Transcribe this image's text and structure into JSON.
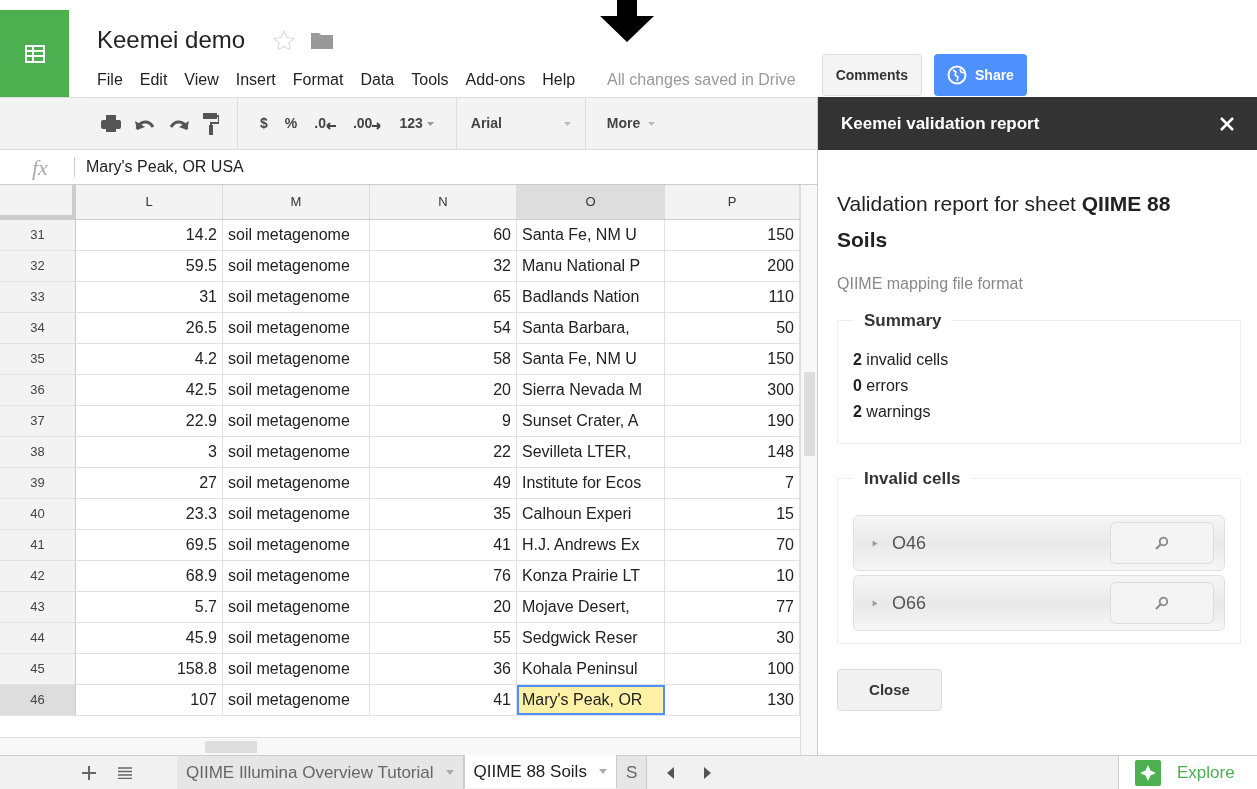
{
  "app": {
    "title": "Keemei demo",
    "starred": false,
    "menu": [
      "File",
      "Edit",
      "View",
      "Insert",
      "Format",
      "Data",
      "Tools",
      "Add-ons",
      "Help"
    ],
    "save_status": "All changes saved in Drive",
    "comments": "Comments",
    "share": "Share"
  },
  "toolbar": {
    "currency": "$",
    "percent": "%",
    "decrease_decimals": ".0",
    "increase_decimals": ".00",
    "number_format": "123",
    "font": "Arial",
    "more": "More"
  },
  "formula_bar": {
    "label": "fx",
    "value": "Mary's Peak, OR USA"
  },
  "sheet": {
    "columns": [
      {
        "label": "L",
        "selected": false
      },
      {
        "label": "M",
        "selected": false
      },
      {
        "label": "N",
        "selected": false
      },
      {
        "label": "O",
        "selected": true
      },
      {
        "label": "P",
        "selected": false
      }
    ],
    "rows": [
      {
        "number": "31",
        "selected": false,
        "cells": [
          "14.2",
          "soil metagenome",
          "60",
          "Santa Fe, NM U",
          "150"
        ]
      },
      {
        "number": "32",
        "selected": false,
        "cells": [
          "59.5",
          "soil metagenome",
          "32",
          "Manu National P",
          "200"
        ]
      },
      {
        "number": "33",
        "selected": false,
        "cells": [
          "31",
          "soil metagenome",
          "65",
          "Badlands Nation",
          "110"
        ]
      },
      {
        "number": "34",
        "selected": false,
        "cells": [
          "26.5",
          "soil metagenome",
          "54",
          "Santa Barbara,",
          "50"
        ]
      },
      {
        "number": "35",
        "selected": false,
        "cells": [
          "4.2",
          "soil metagenome",
          "58",
          "Santa Fe, NM U",
          "150"
        ]
      },
      {
        "number": "36",
        "selected": false,
        "cells": [
          "42.5",
          "soil metagenome",
          "20",
          "Sierra Nevada M",
          "300"
        ]
      },
      {
        "number": "37",
        "selected": false,
        "cells": [
          "22.9",
          "soil metagenome",
          "9",
          "Sunset Crater, A",
          "190"
        ]
      },
      {
        "number": "38",
        "selected": false,
        "cells": [
          "3",
          "soil metagenome",
          "22",
          "Sevilleta LTER,",
          "148"
        ]
      },
      {
        "number": "39",
        "selected": false,
        "cells": [
          "27",
          "soil metagenome",
          "49",
          "Institute for Ecos",
          "7"
        ]
      },
      {
        "number": "40",
        "selected": false,
        "cells": [
          "23.3",
          "soil metagenome",
          "35",
          "Calhoun Experi",
          "15"
        ]
      },
      {
        "number": "41",
        "selected": false,
        "cells": [
          "69.5",
          "soil metagenome",
          "41",
          "H.J. Andrews Ex",
          "70"
        ]
      },
      {
        "number": "42",
        "selected": false,
        "cells": [
          "68.9",
          "soil metagenome",
          "76",
          "Konza Prairie LT",
          "10"
        ]
      },
      {
        "number": "43",
        "selected": false,
        "cells": [
          "5.7",
          "soil metagenome",
          "20",
          "Mojave Desert,",
          "77"
        ]
      },
      {
        "number": "44",
        "selected": false,
        "cells": [
          "45.9",
          "soil metagenome",
          "55",
          "Sedgwick Reser",
          "30"
        ]
      },
      {
        "number": "45",
        "selected": false,
        "cells": [
          "158.8",
          "soil metagenome",
          "36",
          "Kohala Peninsul",
          "100"
        ]
      },
      {
        "number": "46",
        "selected": true,
        "cells": [
          "107",
          "soil metagenome",
          "41",
          "Mary's Peak, OR",
          "130"
        ]
      }
    ]
  },
  "sheet_tabs": [
    {
      "label": "QIIME Illumina Overview Tutorial",
      "selected": false
    },
    {
      "label": "QIIME 88 Soils",
      "selected": true
    },
    {
      "label": "S",
      "selected": false
    }
  ],
  "explore": "Explore",
  "panel": {
    "title": "Keemei validation report",
    "heading": "Validation report for sheet **QIIME 88 Soils**",
    "format": "QIIME mapping file format",
    "summary": {
      "title": "Summary",
      "lines": [
        "**2** invalid cells",
        "**0** errors",
        "**2** warnings"
      ]
    },
    "invalid_cells": {
      "title": "Invalid cells",
      "items": [
        {
          "label": "O46",
          "expanded": false
        },
        {
          "label": "O66",
          "expanded": false
        }
      ]
    },
    "close": "Close"
  }
}
